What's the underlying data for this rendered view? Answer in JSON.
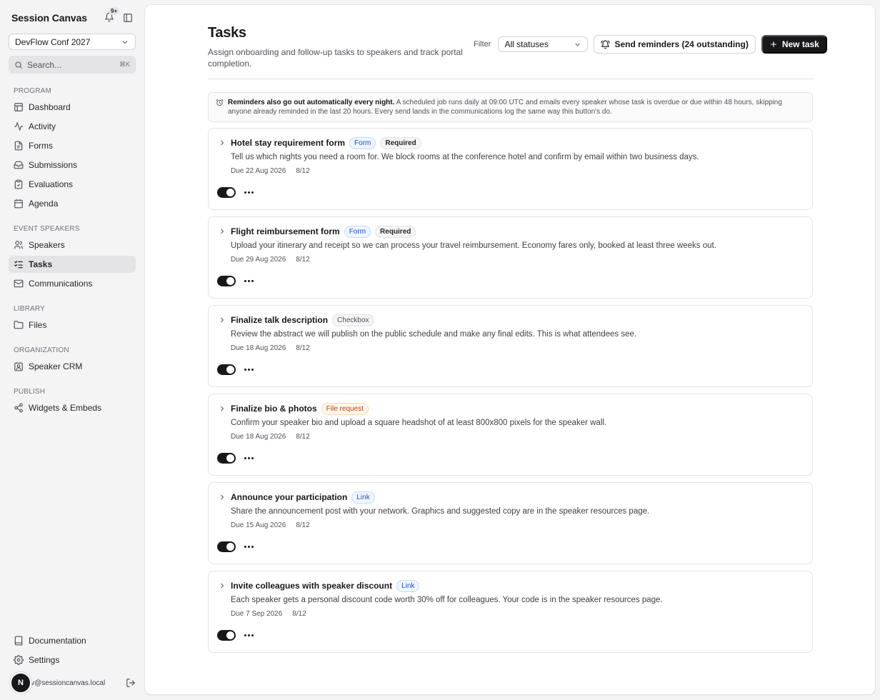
{
  "app": {
    "name": "Session Canvas",
    "notifications": "9+",
    "event": "DevFlow Conf 2027",
    "search_placeholder": "Search...",
    "search_shortcut": "⌘K"
  },
  "sidebar": {
    "groups": [
      {
        "label": "PROGRAM",
        "items": [
          "Dashboard",
          "Activity",
          "Forms",
          "Submissions",
          "Evaluations",
          "Agenda"
        ]
      },
      {
        "label": "EVENT SPEAKERS",
        "items": [
          "Speakers",
          "Tasks",
          "Communications"
        ]
      },
      {
        "label": "LIBRARY",
        "items": [
          "Files"
        ]
      },
      {
        "label": "ORGANIZATION",
        "items": [
          "Speaker CRM"
        ]
      },
      {
        "label": "PUBLISH",
        "items": [
          "Widgets & Embeds"
        ]
      }
    ],
    "active": "Tasks",
    "bottom": [
      "Documentation",
      "Settings"
    ],
    "user_initial": "N",
    "user_email": "dev@sessioncanvas.local"
  },
  "page": {
    "title": "Tasks",
    "subtitle": "Assign onboarding and follow-up tasks to speakers and track portal completion.",
    "filter_label": "Filter",
    "filter_value": "All statuses",
    "reminders_button": "Send reminders (24 outstanding)",
    "new_task_button": "New task"
  },
  "notice": {
    "bold": "Reminders also go out automatically every night.",
    "text": " A scheduled job runs daily at 09:00 UTC and emails every speaker whose task is overdue or due within 48 hours, skipping anyone already reminded in the last 20 hours. Every send lands in the communications log the same way this button's do."
  },
  "tasks": [
    {
      "title": "Hotel stay requirement form",
      "type": "Form",
      "required": "Required",
      "description": "Tell us which nights you need a room for. We block rooms at the conference hotel and confirm by email within two business days.",
      "due": "Due 22 Aug 2026",
      "progress": "8/12",
      "enabled": true
    },
    {
      "title": "Flight reimbursement form",
      "type": "Form",
      "required": "Required",
      "description": "Upload your itinerary and receipt so we can process your travel reimbursement. Economy fares only, booked at least three weeks out.",
      "due": "Due 29 Aug 2026",
      "progress": "8/12",
      "enabled": true
    },
    {
      "title": "Finalize talk description",
      "type": "Checkbox",
      "required": "",
      "description": "Review the abstract we will publish on the public schedule and make any final edits. This is what attendees see.",
      "due": "Due 18 Aug 2026",
      "progress": "8/12",
      "enabled": true
    },
    {
      "title": "Finalize bio & photos",
      "type": "File request",
      "required": "",
      "description": "Confirm your speaker bio and upload a square headshot of at least 800x800 pixels for the speaker wall.",
      "due": "Due 18 Aug 2026",
      "progress": "8/12",
      "enabled": true
    },
    {
      "title": "Announce your participation",
      "type": "Link",
      "required": "",
      "description": "Share the announcement post with your network. Graphics and suggested copy are in the speaker resources page.",
      "due": "Due 15 Aug 2026",
      "progress": "8/12",
      "enabled": true
    },
    {
      "title": "Invite colleagues with speaker discount",
      "type": "Link",
      "required": "",
      "description": "Each speaker gets a personal discount code worth 30% off for colleagues. Your code is in the speaker resources page.",
      "due": "Due 7 Sep 2026",
      "progress": "8/12",
      "enabled": true
    }
  ]
}
